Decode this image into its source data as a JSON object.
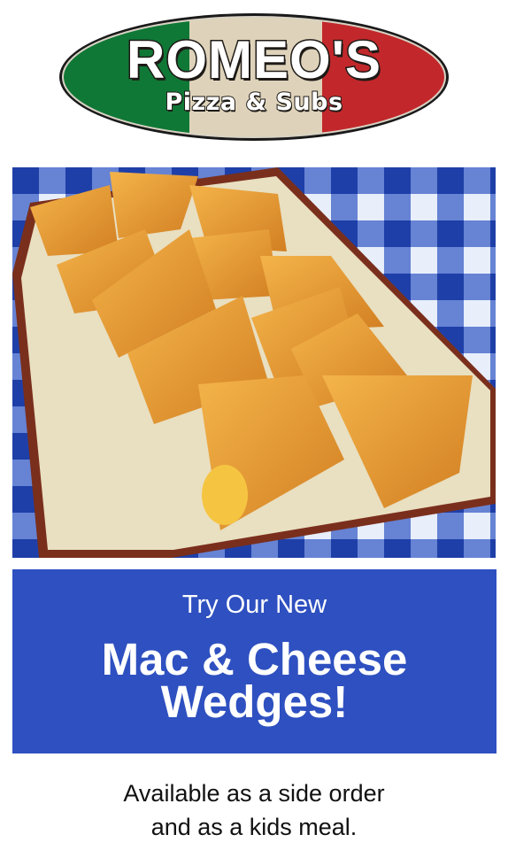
{
  "logo": {
    "title": "ROMEO'S",
    "subtitle": "Pizza & Subs",
    "flag_colors": [
      "#0f8a3e",
      "#f0e6cf",
      "#d42a2f"
    ]
  },
  "photo": {
    "subject": "mac-and-cheese-wedges-on-platter"
  },
  "banner": {
    "intro": "Try Our New",
    "headline_line1": "Mac & Cheese",
    "headline_line2": "Wedges!",
    "background": "#2e50c0"
  },
  "footer": {
    "line1": "Available as a side order",
    "line2": "and as a kids meal."
  }
}
